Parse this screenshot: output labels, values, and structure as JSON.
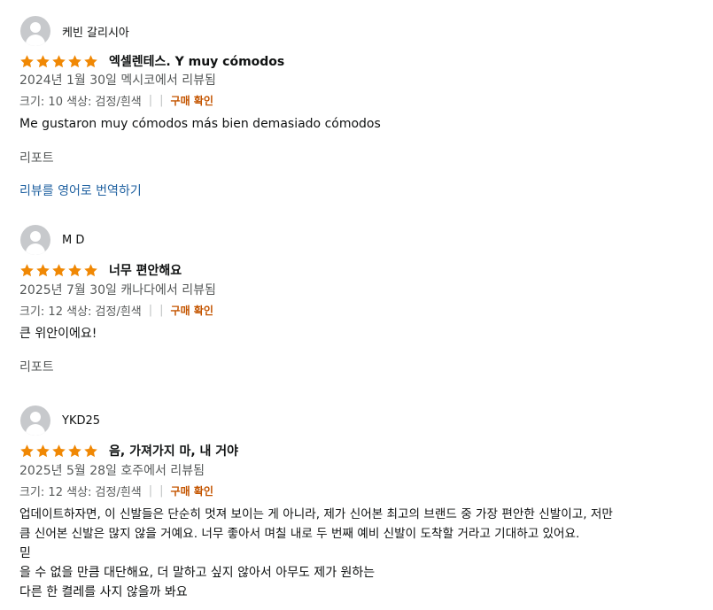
{
  "reviews": [
    {
      "reviewer": "케빈 갈리시아",
      "rating": 5,
      "title": "엑셀렌테스. Y muy cómodos",
      "meta": "2024년 1월 30일 멕시코에서 리뷰됨",
      "attributes": "크기: 10 색상: 검정/흰색",
      "verified": "구매 확인",
      "body": [
        "Me gustaron muy cómodos más bien demasiado cómodos"
      ],
      "report": "리포트",
      "translate": "리뷰를 영어로 번역하기"
    },
    {
      "reviewer": "M D",
      "rating": 5,
      "title": "너무 편안해요",
      "meta": "2025년 7월 30일 캐나다에서 리뷰됨",
      "attributes": "크기: 12 색상: 검정/흰색",
      "verified": "구매 확인",
      "body": [
        "큰 위안이에요!"
      ],
      "report": "리포트"
    },
    {
      "reviewer": "YKD25",
      "rating": 5,
      "title": "음, 가져가지 마, 내 거야",
      "meta": "2025년 5월 28일 호주에서 리뷰됨",
      "attributes": "크기: 12 색상: 검정/흰색",
      "verified": "구매 확인",
      "body": [
        "업데이트하자면, 이 신발들은 단순히 멋져 보이는 게 아니라, 제가 신어본 최고의 브랜드 중 가장 편안한 신발이고, 저만",
        "큼 신어본 신발은 많지 않을 거예요. 너무 좋아서 며칠 내로 두 번째 예비 신발이 도착할 거라고 기대하고 있어요.",
        "믿",
        "을 수 없을 만큼 대단해요, 더 말하고 싶지 않아서 아무도 제가 원하는",
        "다른 한 켤레를 사지 않을까 봐요"
      ]
    }
  ],
  "colors": {
    "star": "#f08804",
    "verified": "#c45500",
    "link": "#2162a1",
    "meta": "#565959"
  }
}
